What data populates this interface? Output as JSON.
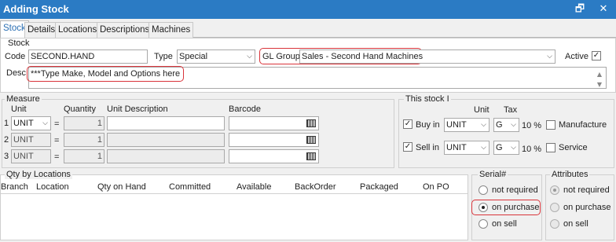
{
  "window": {
    "title": "Adding Stock",
    "restore_icon": "🗗",
    "close_icon": "✕"
  },
  "tabs": [
    {
      "label": "Stock"
    },
    {
      "label": "Details"
    },
    {
      "label": "Locations"
    },
    {
      "label": "Descriptions"
    },
    {
      "label": "Machines"
    }
  ],
  "stock": {
    "section_title": "Stock",
    "code_label": "Code",
    "code_value": "SECOND.HAND",
    "type_label": "Type",
    "type_value": "Special",
    "gl_group_label": "GL Group",
    "gl_group_value": "Sales - Second Hand Machines",
    "active_label": "Active",
    "active_checked": true,
    "desc_label": "Desc",
    "desc_value": "***Type Make, Model and Options here"
  },
  "measure": {
    "section_title": "Measure",
    "col_unit": "Unit",
    "col_quantity": "Quantity",
    "col_unit_description": "Unit Description",
    "col_barcode": "Barcode",
    "rows": [
      {
        "index": "1",
        "unit": "UNIT",
        "equals": "=",
        "quantity": "1"
      },
      {
        "index": "2",
        "unit": "UNIT",
        "equals": "=",
        "quantity": "1"
      },
      {
        "index": "3",
        "unit": "UNIT",
        "equals": "=",
        "quantity": "1"
      }
    ]
  },
  "this_stock": {
    "section_title": "This stock I",
    "col_unit": "Unit",
    "col_tax": "Tax",
    "buy_label": "Buy in",
    "buy_unit": "UNIT",
    "buy_tax": "G",
    "buy_tax_pct": "10 %",
    "sell_label": "Sell in",
    "sell_unit": "UNIT",
    "sell_tax": "G",
    "sell_tax_pct": "10 %",
    "manufacture_label": "Manufacture",
    "service_label": "Service"
  },
  "qty_by_locations": {
    "section_title": "Qty by Locations",
    "columns": [
      "Branch",
      "Location",
      "Qty on Hand",
      "Committed",
      "Available",
      "BackOrder",
      "Packaged",
      "On PO"
    ]
  },
  "serial": {
    "section_title": "Serial#",
    "options": [
      "not required",
      "on purchase",
      "on sell"
    ],
    "selected": "on purchase"
  },
  "attributes": {
    "section_title": "Attributes",
    "options": [
      "not required",
      "on purchase",
      "on sell"
    ],
    "selected": "not required"
  },
  "colors": {
    "titlebar": "#2b7bc4",
    "highlight": "#d9343a",
    "active_tab": "#2b6fb3"
  }
}
